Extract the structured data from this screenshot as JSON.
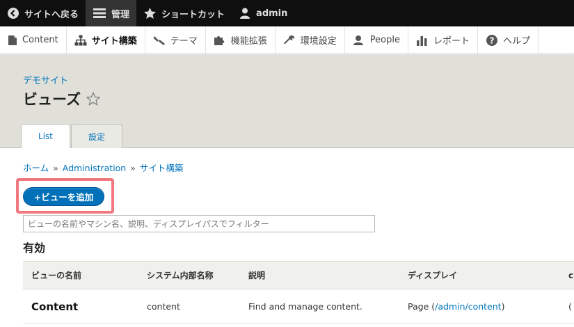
{
  "toolbar": {
    "back": "サイトへ戻る",
    "manage": "管理",
    "shortcuts": "ショートカット",
    "user": "admin"
  },
  "tray": {
    "items": [
      "Content",
      "サイト構築",
      "テーマ",
      "機能拡張",
      "環境設定",
      "People",
      "レポート",
      "ヘルプ"
    ]
  },
  "header": {
    "site_link": "デモサイト",
    "title": "ビューズ",
    "tabs": [
      "List",
      "設定"
    ]
  },
  "breadcrumb": {
    "items": [
      "ホーム",
      "Administration",
      "サイト構築"
    ],
    "separator": "»"
  },
  "add_button": "+ビューを追加",
  "filter": {
    "placeholder": "ビューの名前やマシン名、説明、ディスプレイパスでフィルター",
    "value": ""
  },
  "section_title": "有効",
  "table": {
    "headers": [
      "ビューの名前",
      "システム内部名称",
      "説明",
      "ディスプレイ",
      "c"
    ],
    "rows": [
      {
        "name": "Content",
        "machine": "content",
        "description": "Find and manage content.",
        "display_prefix": "Page (",
        "display_link": "/admin/content",
        "display_suffix": ")",
        "extra": "("
      }
    ]
  },
  "colors": {
    "toolbar_bg": "#0f0f0f",
    "link": "#0074bd",
    "button": "#0071b8",
    "highlight": "#f0787e",
    "header_bg": "#e0e0d8"
  }
}
